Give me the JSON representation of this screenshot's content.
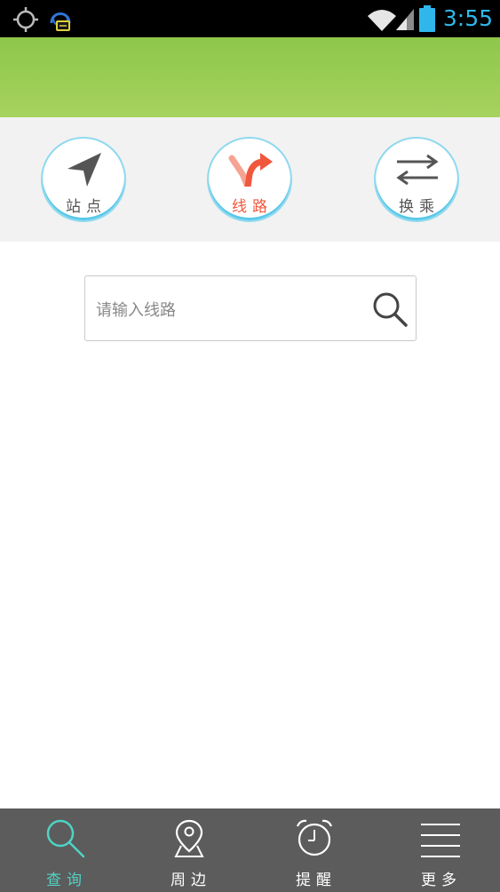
{
  "status_bar": {
    "time": "3:55",
    "icons": [
      "locate-icon",
      "assistant-icon",
      "wifi-icon",
      "signal-icon",
      "battery-icon"
    ],
    "time_color": "#2fb7ec"
  },
  "header": {
    "color": "#9ccd56"
  },
  "modes": {
    "active": "route",
    "station": {
      "label": "站点",
      "icon": "navigation-arrow-icon"
    },
    "route": {
      "label": "线路",
      "icon": "route-split-icon"
    },
    "transfer": {
      "label": "换乘",
      "icon": "transfer-arrows-icon"
    }
  },
  "search": {
    "placeholder": "请输入线路",
    "value": "",
    "icon": "search-icon"
  },
  "bottom_nav": {
    "active": "query",
    "items": [
      {
        "key": "query",
        "label": "查询",
        "icon": "search-icon"
      },
      {
        "key": "nearby",
        "label": "周边",
        "icon": "map-pin-icon"
      },
      {
        "key": "remind",
        "label": "提醒",
        "icon": "alarm-clock-icon"
      },
      {
        "key": "more",
        "label": "更多",
        "icon": "menu-lines-icon"
      }
    ]
  },
  "colors": {
    "accent_active_nav": "#4fd3c3",
    "active_mode": "#f0573d",
    "ring": "#59c8e8",
    "nav_background": "#5c5c5c"
  }
}
